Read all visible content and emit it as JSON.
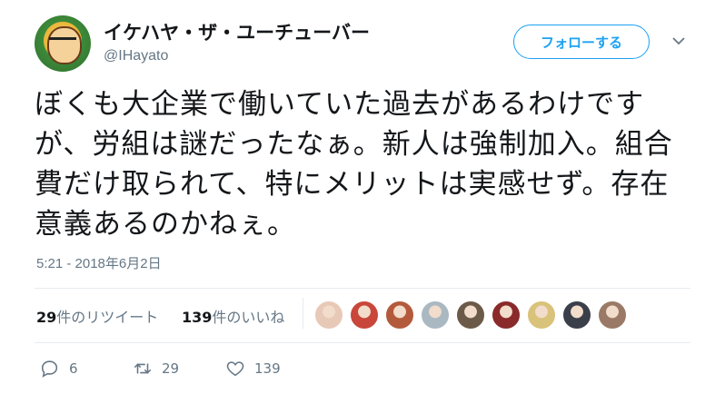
{
  "user": {
    "display_name": "イケハヤ・ザ・ユーチューバー",
    "handle": "@IHayato"
  },
  "follow_button": {
    "label": "フォローする"
  },
  "tweet": {
    "text": "ぼくも大企業で働いていた過去があるわけですが、労組は謎だったなぁ。新人は強制加入。組合費だけ取られて、特にメリットは実感せず。存在意義あるのかねぇ。",
    "timestamp": "5:21 - 2018年6月2日"
  },
  "stats": {
    "retweets_count": "29",
    "retweets_label": "件のリツイート",
    "likes_count": "139",
    "likes_label": "件のいいね"
  },
  "likers": [
    {
      "name": "liker-avatar",
      "color": "#e8c9b8"
    },
    {
      "name": "liker-avatar",
      "color": "#c9463a"
    },
    {
      "name": "liker-avatar",
      "color": "#b45a3c"
    },
    {
      "name": "liker-avatar",
      "color": "#aab8c2"
    },
    {
      "name": "liker-avatar",
      "color": "#6b5a48"
    },
    {
      "name": "liker-avatar",
      "color": "#8a2a2a"
    },
    {
      "name": "liker-avatar",
      "color": "#d9c27a"
    },
    {
      "name": "liker-avatar",
      "color": "#3a3f4a"
    },
    {
      "name": "liker-avatar",
      "color": "#9a7a66"
    }
  ],
  "actions": {
    "reply_count": "6",
    "retweet_count": "29",
    "like_count": "139"
  },
  "colors": {
    "accent": "#1da1f2",
    "secondary_text": "#657786",
    "primary_text": "#14171a",
    "divider": "#e6ecf0"
  },
  "icons": {
    "reply": "reply-icon",
    "retweet": "retweet-icon",
    "like": "heart-icon",
    "more": "chevron-down-icon"
  }
}
